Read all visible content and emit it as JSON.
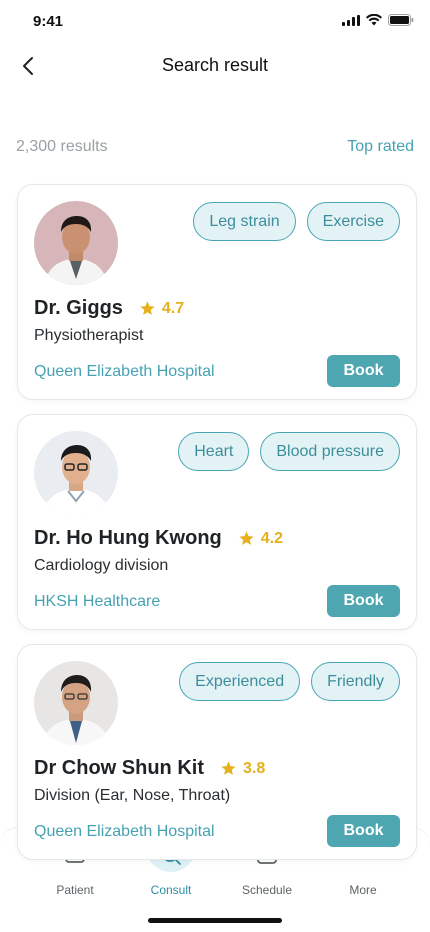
{
  "status_bar": {
    "time": "9:41"
  },
  "nav": {
    "title": "Search result"
  },
  "results": {
    "count": "2,300 results",
    "sort": "Top rated"
  },
  "doctors": [
    {
      "name": "Dr. Giggs",
      "rating": "4.7",
      "specialty": "Physiotherapist",
      "hospital": "Queen Elizabeth Hospital",
      "tags": [
        "Leg strain",
        "Exercise"
      ],
      "book_label": "Book"
    },
    {
      "name": "Dr. Ho Hung Kwong",
      "rating": "4.2",
      "specialty": "Cardiology division",
      "hospital": "HKSH Healthcare",
      "tags": [
        "Heart",
        "Blood pressure"
      ],
      "book_label": "Book"
    },
    {
      "name": "Dr Chow Shun Kit",
      "rating": "3.8",
      "specialty": "Division (Ear, Nose, Throat)",
      "hospital": "Queen Elizabeth Hospital",
      "tags": [
        "Experienced",
        "Friendly"
      ],
      "book_label": "Book"
    }
  ],
  "tab_bar": {
    "items": [
      {
        "label": "Patient",
        "icon": "patient-icon"
      },
      {
        "label": "Consult",
        "icon": "consult-icon",
        "active": true
      },
      {
        "label": "Schedule",
        "icon": "schedule-icon"
      },
      {
        "label": "More",
        "icon": "more-icon"
      }
    ]
  },
  "colors": {
    "accent": "#46a2b2",
    "book_button": "#4ea6b1",
    "tag_bg": "#e3f2f4",
    "rating": "#e6b01d"
  }
}
